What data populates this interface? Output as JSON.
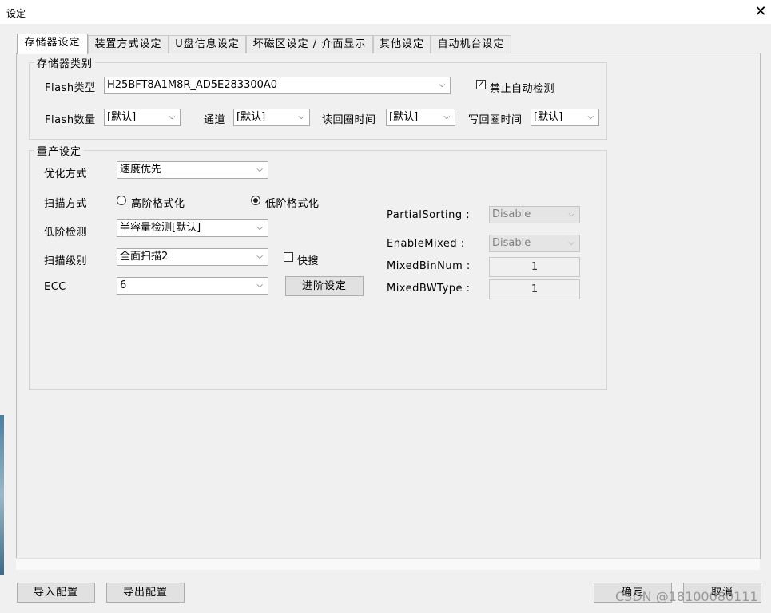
{
  "window": {
    "title": "设定",
    "close_glyph": "✕"
  },
  "tabs": [
    {
      "label": "存储器设定",
      "active": true
    },
    {
      "label": "装置方式设定"
    },
    {
      "label": "U盘信息设定"
    },
    {
      "label": "坏磁区设定 / 介面显示"
    },
    {
      "label": "其他设定"
    },
    {
      "label": "自动机台设定"
    }
  ],
  "storage": {
    "group_title": "存储器类别",
    "flash_type": {
      "label": "Flash类型",
      "value": "H25BFT8A1M8R_AD5E283300A0"
    },
    "disable_auto_detect": {
      "label": "禁止自动检测",
      "checked": true
    },
    "flash_count": {
      "label": "Flash数量",
      "value": "[默认]"
    },
    "channel": {
      "label": "通道",
      "value": "[默认]"
    },
    "read_cycle": {
      "label": "读回圈时间",
      "value": "[默认]"
    },
    "write_cycle": {
      "label": "写回圈时间",
      "value": "[默认]"
    }
  },
  "production": {
    "group_title": "量产设定",
    "optimize": {
      "label": "优化方式",
      "value": "速度优先"
    },
    "scan_mode": {
      "label": "扫描方式",
      "options": [
        "高阶格式化",
        "低阶格式化"
      ],
      "selected": "低阶格式化"
    },
    "low_level_check": {
      "label": "低阶检测",
      "value": "半容量检测[默认]"
    },
    "scan_level": {
      "label": "扫描级别",
      "value": "全面扫描2"
    },
    "quick_scan": {
      "label": "快搜",
      "checked": false
    },
    "ecc": {
      "label": "ECC",
      "value": "6"
    },
    "advanced_button": "进阶设定",
    "partial_sorting": {
      "label": "PartialSorting :",
      "value": "Disable"
    },
    "enable_mixed": {
      "label": "EnableMixed :",
      "value": "Disable"
    },
    "mixed_bin_num": {
      "label": "MixedBinNum :",
      "value": "1"
    },
    "mixed_bw_type": {
      "label": "MixedBWType :",
      "value": "1"
    }
  },
  "footer": {
    "import_button": "导入配置",
    "export_button": "导出配置",
    "ok_button": "确定",
    "cancel_button": "取消",
    "watermark": "CSDN @18100080111"
  },
  "icons": {
    "dropdown": "chevron-down-icon",
    "check": "check-icon",
    "close": "close-icon"
  }
}
